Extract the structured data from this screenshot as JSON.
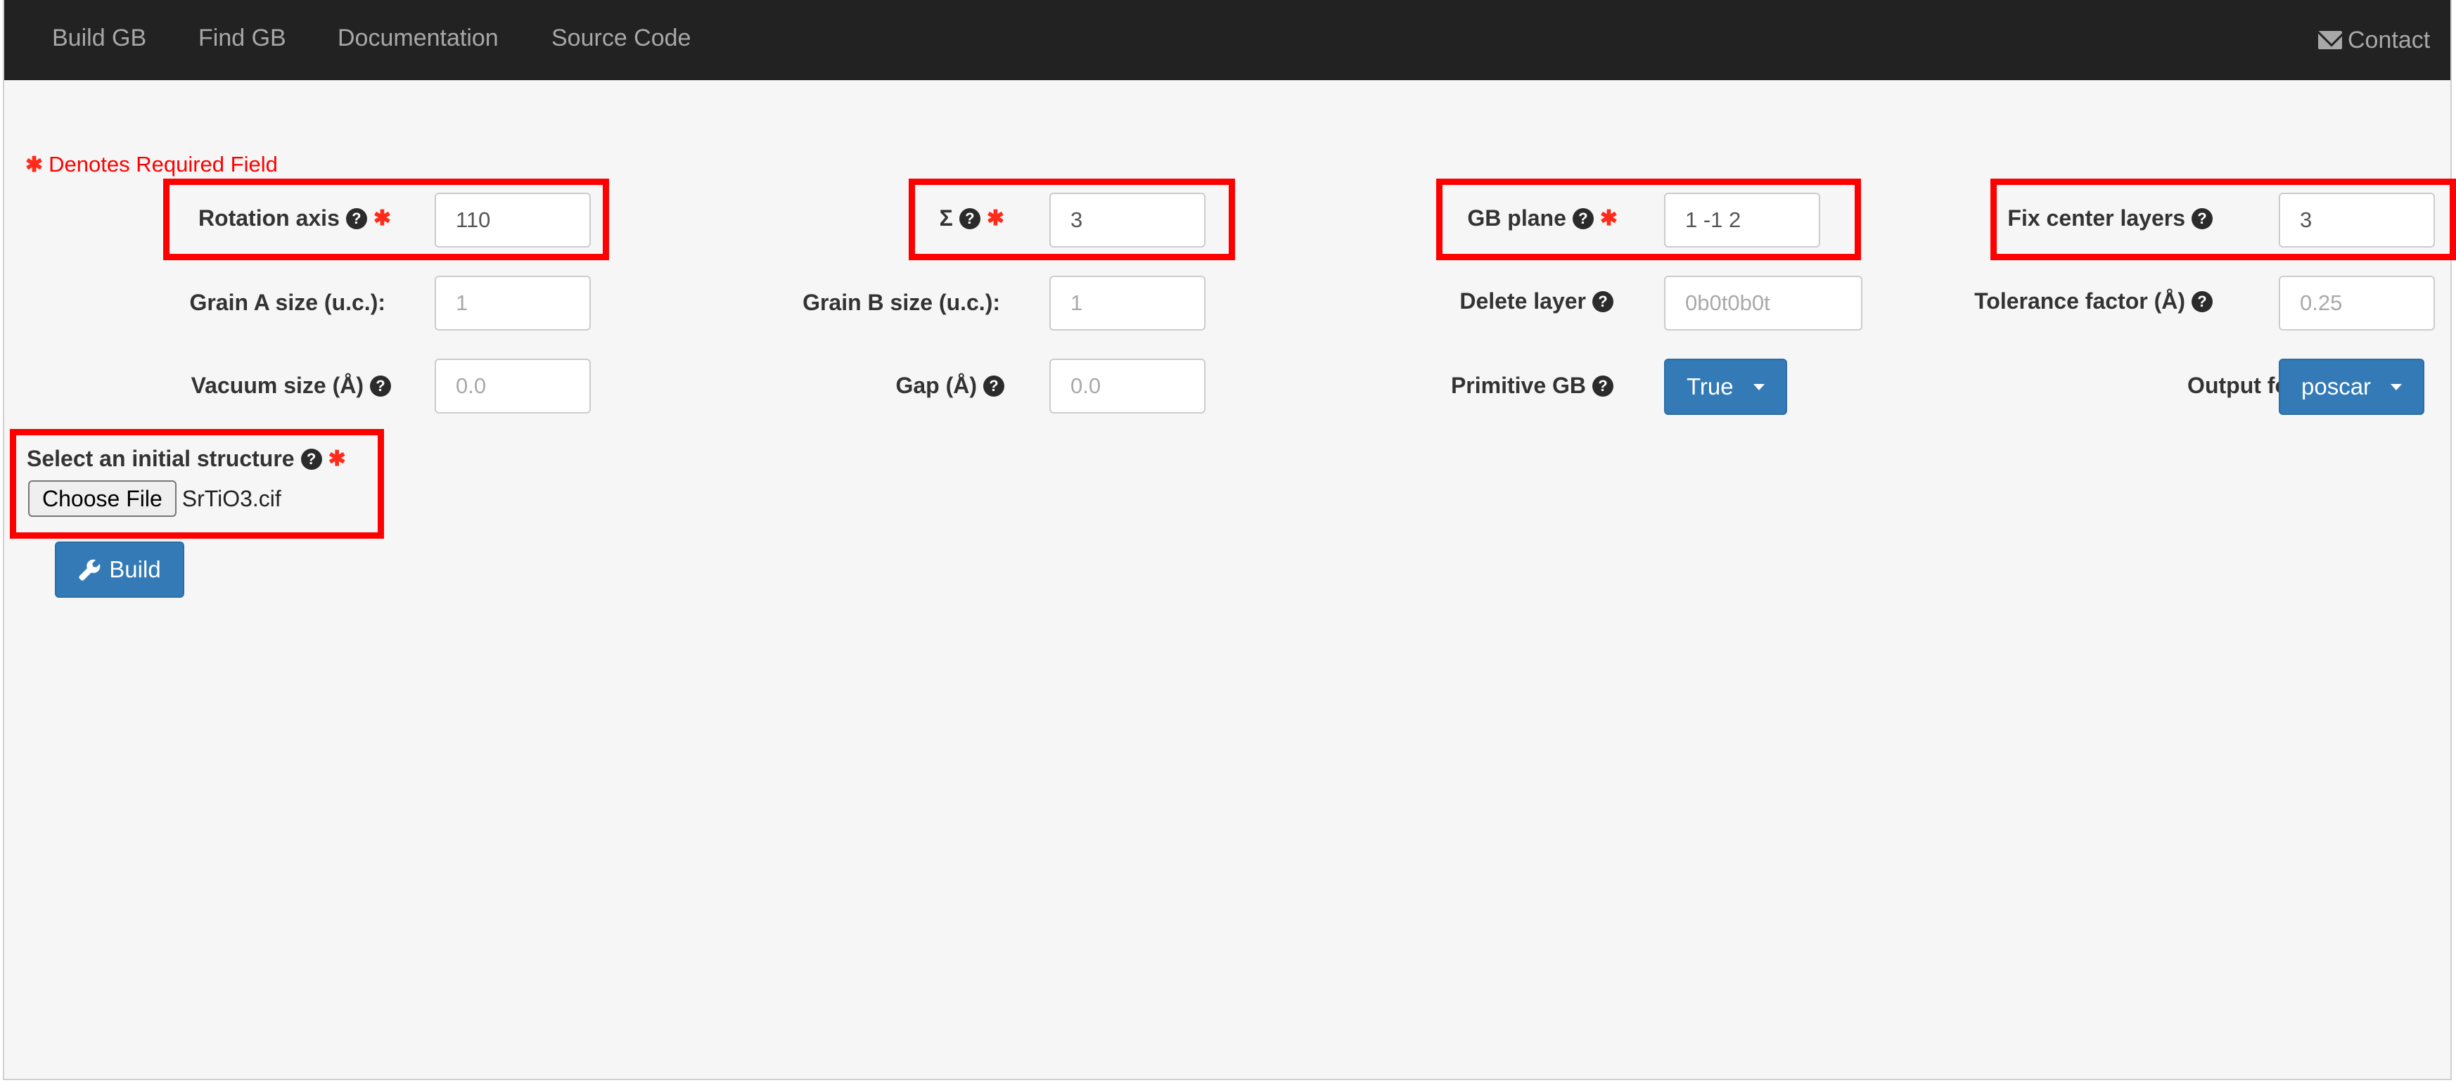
{
  "nav": {
    "items": [
      "Build GB",
      "Find GB",
      "Documentation",
      "Source Code"
    ],
    "contact": "Contact"
  },
  "required_note": "Denotes Required Field",
  "fields": {
    "rotation_axis": {
      "label": "Rotation axis",
      "value": "110"
    },
    "sigma": {
      "label": "Σ",
      "value": "3"
    },
    "gb_plane": {
      "label": "GB plane",
      "value": "1 -1 2"
    },
    "fix_center_layers": {
      "label": "Fix center layers",
      "value": "3"
    },
    "grain_a_size": {
      "label": "Grain A size (u.c.):",
      "placeholder": "1"
    },
    "grain_b_size": {
      "label": "Grain B size (u.c.):",
      "placeholder": "1"
    },
    "delete_layer": {
      "label": "Delete layer",
      "placeholder": "0b0t0b0t"
    },
    "tolerance_factor": {
      "label": "Tolerance factor (Å)",
      "placeholder": "0.25"
    },
    "vacuum_size": {
      "label": "Vacuum size (Å)",
      "placeholder": "0.0"
    },
    "gap": {
      "label": "Gap (Å)",
      "placeholder": "0.0"
    },
    "primitive_gb": {
      "label": "Primitive GB",
      "value": "True"
    },
    "output_format": {
      "label": "Output format:",
      "value": "poscar"
    }
  },
  "structure": {
    "label": "Select an initial structure",
    "choose_file": "Choose File",
    "file_name": "SrTiO3.cif"
  },
  "build_button": "Build",
  "icons": {
    "help": "question-circle-icon",
    "required": "asterisk-icon",
    "contact": "envelope-icon",
    "build": "wrench-icon",
    "dropdown": "caret-down-icon"
  },
  "colors": {
    "navbar": "#222222",
    "primary": "#337ab7",
    "required": "#ff0000",
    "highlight": "#ff0000"
  }
}
